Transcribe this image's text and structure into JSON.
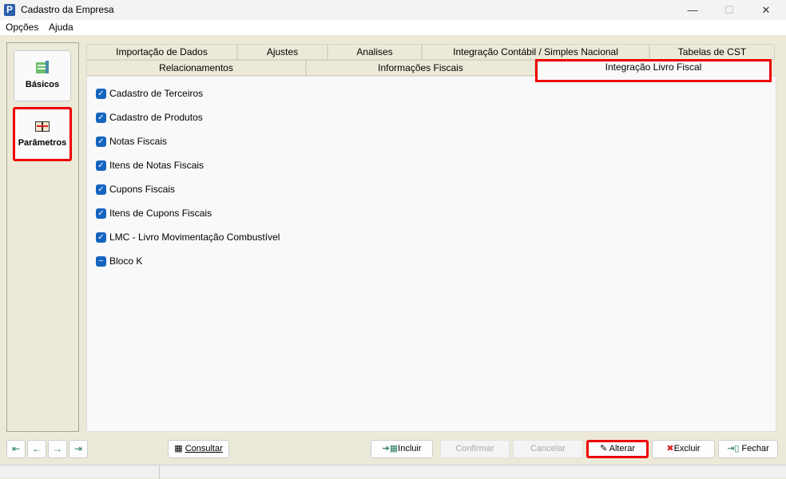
{
  "window": {
    "title": "Cadastro da Empresa",
    "logo": "P",
    "minimize": "—",
    "maximize": "☐",
    "close": "✕"
  },
  "menu": [
    "Opções",
    "Ajuda"
  ],
  "sidebar": [
    {
      "label": "Básicos",
      "icon": "basicos-icon"
    },
    {
      "label": "Parâmetros",
      "icon": "book-icon",
      "selected": true
    }
  ],
  "tabs_row1": [
    "Importação de Dados",
    "Ajustes",
    "Analises",
    "Integração Contábil / Simples Nacional",
    "Tabelas de CST"
  ],
  "tabs_row2": [
    "Relacionamentos",
    "Informações Fiscais",
    "Integração Livro Fiscal"
  ],
  "active_tab": "Integração Livro Fiscal",
  "checkboxes": [
    {
      "label": "Cadastro de Terceiros",
      "state": "checked"
    },
    {
      "label": "Cadastro de Produtos",
      "state": "checked"
    },
    {
      "label": "Notas Fiscais",
      "state": "checked"
    },
    {
      "label": "Itens de Notas Fiscais",
      "state": "checked"
    },
    {
      "label": "Cupons Fiscais",
      "state": "checked"
    },
    {
      "label": "Itens de Cupons Fiscais",
      "state": "checked"
    },
    {
      "label": "LMC - Livro Movimentação Combustível",
      "state": "checked"
    },
    {
      "label": "Bloco K",
      "state": "indeterminate"
    }
  ],
  "buttons": {
    "consultar": "Consultar",
    "incluir": "Incluir",
    "confirmar": "Confirmar",
    "cancelar": "Cancelar",
    "alterar": "Alterar",
    "excluir": "Excluir",
    "fechar": "Fechar"
  },
  "nav_arrows": [
    "⇤",
    "←",
    "→",
    "⇥"
  ]
}
